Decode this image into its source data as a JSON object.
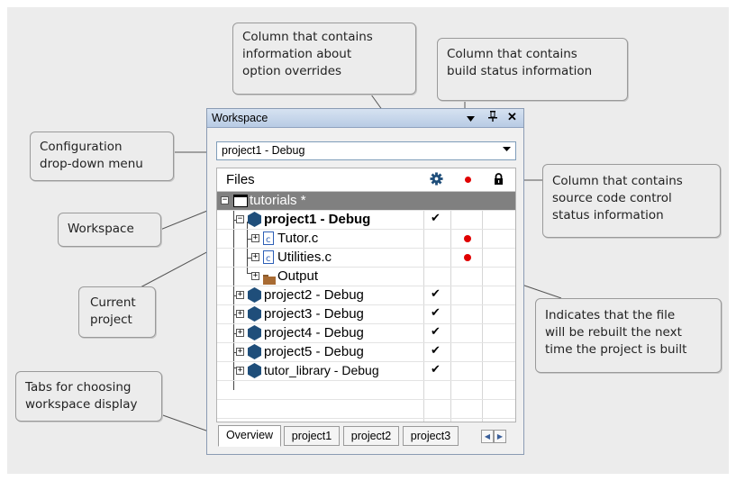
{
  "callouts": {
    "overrides": "Column that contains\ninformation about\noption overrides",
    "build_status": "Column that contains\nbuild status information",
    "config_menu": "Configuration\ndrop-down menu",
    "workspace": "Workspace",
    "scc_status": "Column that contains\nsource code control\nstatus information",
    "current_project": "Current\nproject",
    "rebuild": "Indicates that the file\nwill be rebuilt the next\ntime the project is built",
    "tabs": "Tabs for choosing\nworkspace display"
  },
  "window": {
    "title": "Workspace",
    "pin_icon": "pin-icon",
    "close_icon": "close-icon",
    "menu_icon": "dropdown-arrow-icon"
  },
  "config": {
    "value": "project1 - Debug"
  },
  "tree": {
    "header": {
      "files": "Files",
      "override_col_icon": "gear-icon",
      "build_col_icon": "red-dot-icon",
      "scc_col_icon": "lock-icon"
    },
    "rows": [
      {
        "label": "tutorials *",
        "icon": "workspace-icon",
        "selected": true,
        "check": "",
        "build_pending": false
      },
      {
        "label": "project1 - Debug",
        "icon": "project-icon",
        "bold": true,
        "check": "✔",
        "build_pending": false
      },
      {
        "label": "Tutor.c",
        "icon": "c-file-icon",
        "check": "",
        "build_pending": true
      },
      {
        "label": "Utilities.c",
        "icon": "c-file-icon",
        "check": "",
        "build_pending": true
      },
      {
        "label": "Output",
        "icon": "folder-icon",
        "check": "",
        "build_pending": false
      },
      {
        "label": "project2 - Debug",
        "icon": "project-icon",
        "check": "✔",
        "build_pending": false
      },
      {
        "label": "project3 - Debug",
        "icon": "project-icon",
        "check": "✔",
        "build_pending": false
      },
      {
        "label": "project4 - Debug",
        "icon": "project-icon",
        "check": "✔",
        "build_pending": false
      },
      {
        "label": "project5 - Debug",
        "icon": "project-icon",
        "check": "✔",
        "build_pending": false
      },
      {
        "label": "tutor_library - Debug",
        "icon": "project-icon",
        "check": "✔",
        "build_pending": false
      }
    ]
  },
  "tabs": [
    "Overview",
    "project1",
    "project2",
    "project3"
  ],
  "colors": {
    "build_dot": "#e00000",
    "project_hex": "#1f4e7a",
    "selected_row": "#808080"
  }
}
